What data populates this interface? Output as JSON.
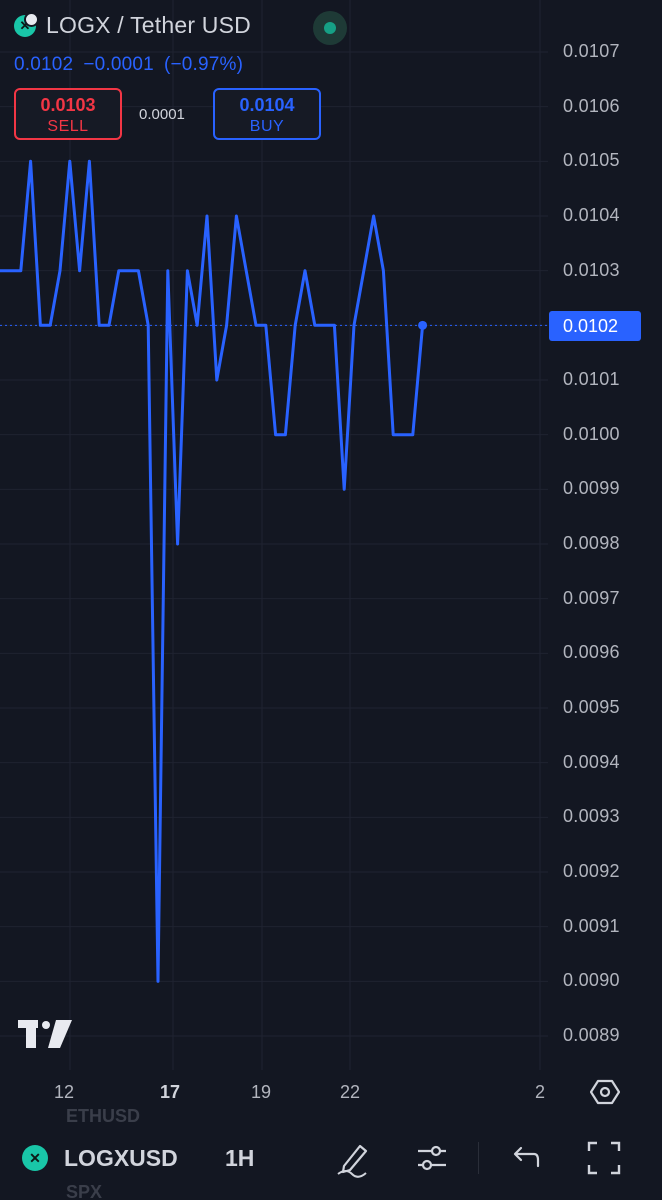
{
  "header": {
    "symbol_title": "LOGX / Tether USD",
    "last_price": "0.0102",
    "change": "−0.0001",
    "change_pct": "(−0.97%)",
    "sell_price": "0.0103",
    "sell_label": "SELL",
    "spread": "0.0001",
    "buy_price": "0.0104",
    "buy_label": "BUY"
  },
  "price_axis": {
    "labels": [
      "0.0107",
      "0.0106",
      "0.0105",
      "0.0104",
      "0.0103",
      "0.0102",
      "0.0101",
      "0.0100",
      "0.0099",
      "0.0098",
      "0.0097",
      "0.0096",
      "0.0095",
      "0.0094",
      "0.0093",
      "0.0092",
      "0.0091",
      "0.0090",
      "0.0089"
    ],
    "current_price_tag": "0.0102"
  },
  "time_axis": {
    "labels": [
      {
        "text": "12",
        "bold": false
      },
      {
        "text": "17",
        "bold": true
      },
      {
        "text": "19",
        "bold": false
      },
      {
        "text": "22",
        "bold": false
      },
      {
        "text": "2",
        "bold": false
      }
    ]
  },
  "chart_data": {
    "type": "line",
    "series": [
      {
        "values": [
          0.0103,
          0.0103,
          0.0105,
          0.0102,
          0.0102,
          0.0103,
          0.0105,
          0.0103,
          0.0105,
          0.0102,
          0.0102,
          0.0103,
          0.0103,
          0.0103,
          0.0102,
          0.009,
          0.0103,
          0.0098,
          0.0103,
          0.0102,
          0.0104,
          0.0101,
          0.0102,
          0.0104,
          0.0103,
          0.0102,
          0.0102,
          0.01,
          0.01,
          0.0102,
          0.0103,
          0.0102,
          0.0102,
          0.0102,
          0.0099,
          0.0102,
          0.0103,
          0.0104,
          0.0103,
          0.01,
          0.01,
          0.01,
          0.0102
        ]
      }
    ],
    "ylim": [
      0.00887,
      0.01076
    ],
    "current_price": 0.0102,
    "grid": true,
    "line_color": "#2962ff"
  },
  "toolbar": {
    "symbol": "LOGXUSD",
    "interval": "1H",
    "ghost_top": "ETHUSD",
    "ghost_bottom": "SPX"
  },
  "colors": {
    "background": "#131722",
    "accent": "#2962ff",
    "sell": "#f23645",
    "brand": "#19c6a8"
  }
}
